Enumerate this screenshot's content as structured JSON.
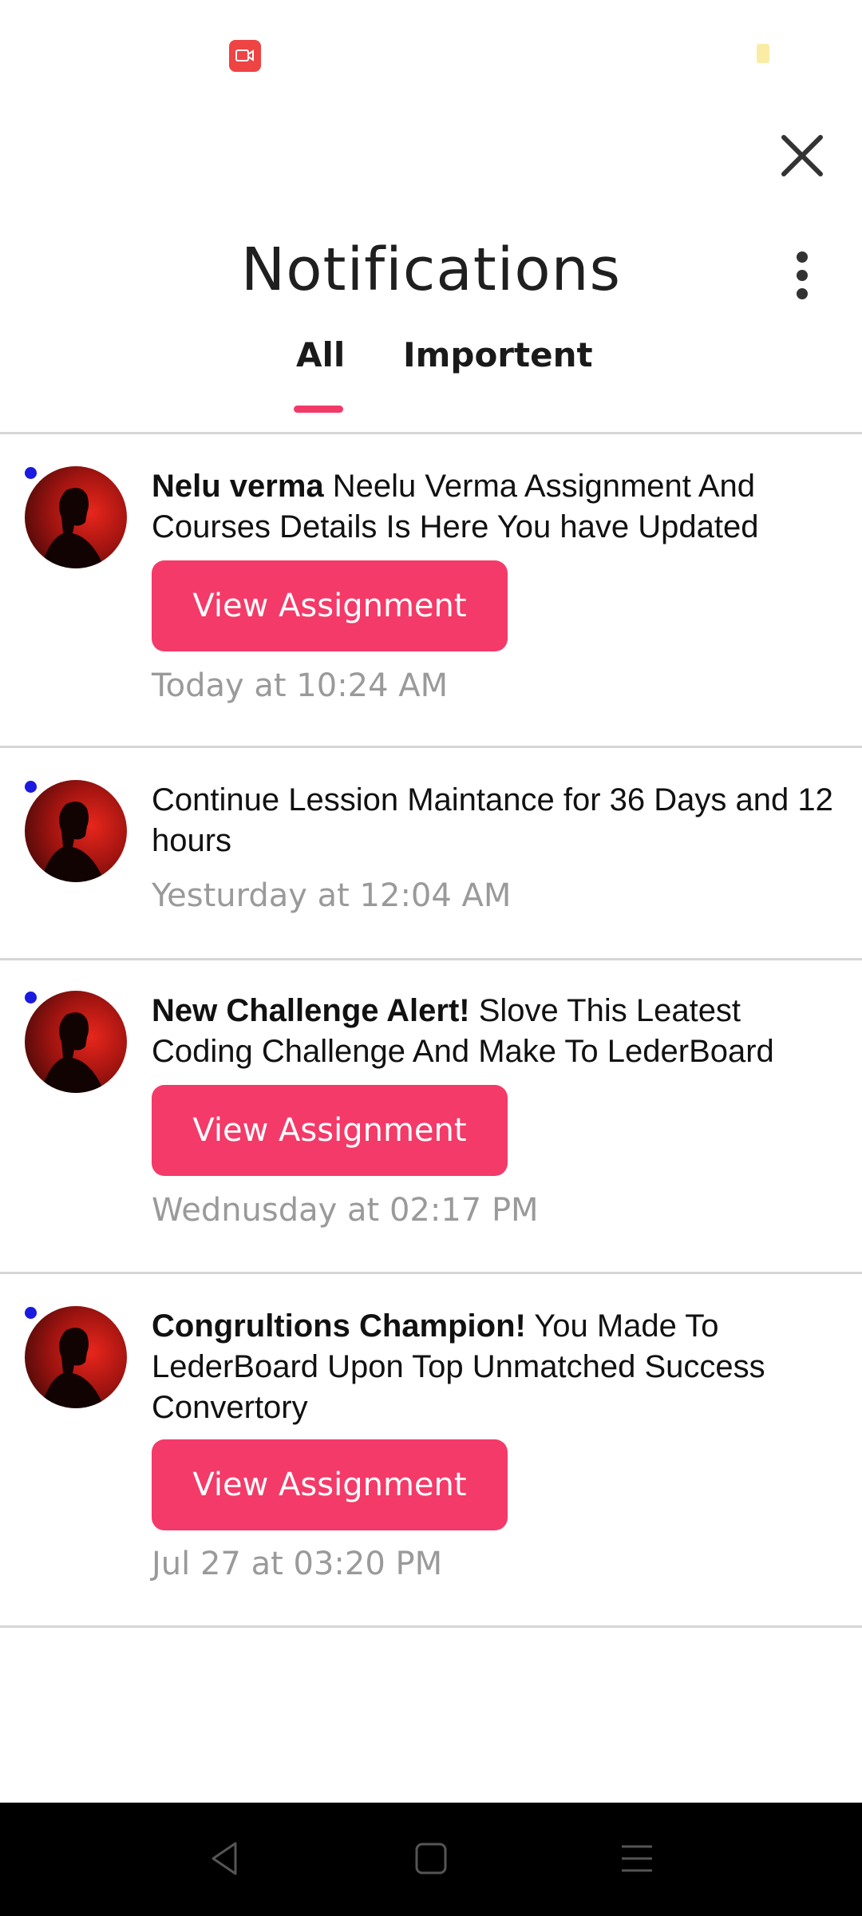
{
  "header": {
    "title": "Notifications",
    "close_icon": "close-icon",
    "more_icon": "more-vertical-icon"
  },
  "tabs": [
    {
      "label": "All",
      "selected": true
    },
    {
      "label": "Importent",
      "selected": false
    }
  ],
  "notifications": [
    {
      "bold": "Nelu verma",
      "text": " Neelu Verma Assignment And Courses Details Is Here You have Updated",
      "button": "View Assignment",
      "time": "Today at 10:24 AM",
      "unread": true
    },
    {
      "bold": "",
      "text": "Continue Lession Maintance for 36 Days and 12 hours",
      "button": "",
      "time": "Yesturday at 12:04 AM",
      "unread": true
    },
    {
      "bold": "New Challenge Alert!",
      "text": " Slove This Leatest Coding Challenge And Make To LederBoard",
      "button": "View Assignment",
      "time": "Wednusday at 02:17 PM",
      "unread": true
    },
    {
      "bold": "Congrultions Champion!",
      "text": " You Made To LederBoard Upon Top Unmatched Success Convertory",
      "button": "View Assignment",
      "time": "Jul 27 at 03:20 PM",
      "unread": true
    }
  ],
  "colors": {
    "accent": "#f43a68",
    "unread_dot": "#1a1ae0",
    "time_text": "#9a9a9a"
  },
  "navbar": [
    "back-icon",
    "home-icon",
    "recents-icon"
  ]
}
